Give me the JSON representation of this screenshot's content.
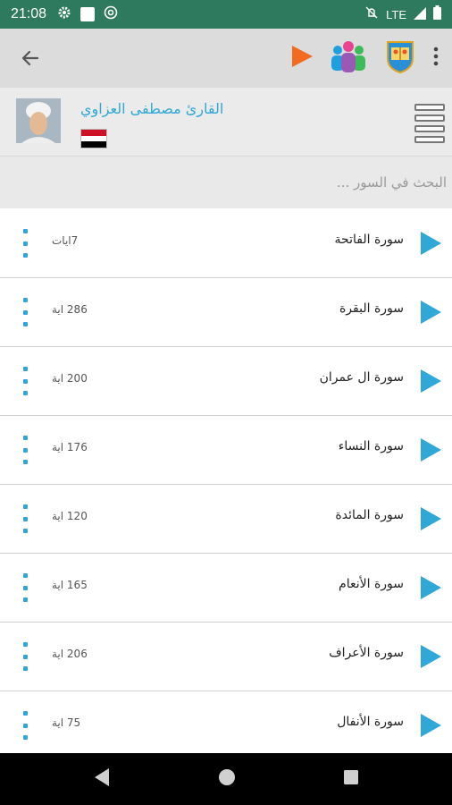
{
  "status_bar": {
    "time": "21:08",
    "network": "LTE",
    "icons_left": [
      "gear-icon",
      "square-icon",
      "at-sign-icon"
    ],
    "icons_right": [
      "mute-icon",
      "signal-icon",
      "battery-icon"
    ]
  },
  "toolbar": {
    "icons": [
      "back-arrow-icon",
      "play-icon",
      "people-icon",
      "quran-book-icon",
      "overflow-menu-icon"
    ]
  },
  "reader": {
    "name": "القارئ مصطفى العزاوي",
    "flag": "iraq-flag"
  },
  "search": {
    "placeholder": "البحث في السور ..."
  },
  "surahs": [
    {
      "name": "سورة الفاتحة",
      "count": "7ايات"
    },
    {
      "name": "سورة البقرة",
      "count": "286 اية"
    },
    {
      "name": "سورة ال عمران",
      "count": "200 اية"
    },
    {
      "name": "سورة النساء",
      "count": "176 اية"
    },
    {
      "name": "سورة المائدة",
      "count": "120 اية"
    },
    {
      "name": "سورة الأنعام",
      "count": "165 اية"
    },
    {
      "name": "سورة الأعراف",
      "count": "206 اية"
    },
    {
      "name": "سورة الأنفال",
      "count": "75 اية"
    }
  ],
  "colors": {
    "status_bar": "#2e7a5e",
    "toolbar": "#dcdcdc",
    "accent_blue": "#2fa8d8",
    "play_orange": "#f26b21"
  }
}
